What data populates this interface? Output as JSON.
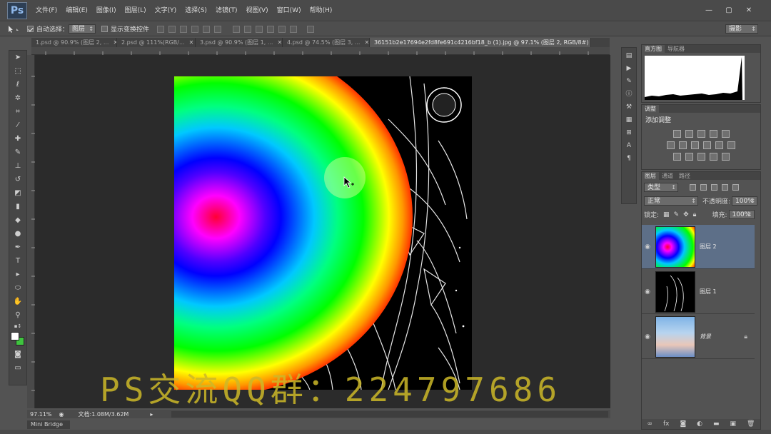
{
  "app": {
    "logo": "Ps"
  },
  "menu": [
    "文件(F)",
    "编辑(E)",
    "图像(I)",
    "图层(L)",
    "文字(Y)",
    "选择(S)",
    "滤镜(T)",
    "视图(V)",
    "窗口(W)",
    "帮助(H)"
  ],
  "window_controls": {
    "minimize": "—",
    "restore": "▢",
    "close": "✕"
  },
  "options": {
    "auto_select_label": "自动选择：",
    "auto_select_value": "图层",
    "show_transform_label": "显示变换控件",
    "workspace": "摄影"
  },
  "tabs": [
    {
      "label": "1.psd @ 90.9% (图层 2, ..."
    },
    {
      "label": "2.psd @ 111%(RGB/..."
    },
    {
      "label": "3.psd @ 90.9% (图层 1, ..."
    },
    {
      "label": "4.psd @ 74.5% (图层 3, ..."
    },
    {
      "label": "36151b2e17694e2fd8fe691c4216bf18_b (1).jpg @ 97.1% (图层 2, RGB/8#) *"
    }
  ],
  "status": {
    "zoom": "97.11%",
    "doc": "文档:1.08M/3.62M"
  },
  "mini_bridge": "Mini Bridge",
  "panels": {
    "hist_tabs": [
      "直方图",
      "导航器"
    ],
    "adj_tab": "调整",
    "adj_title": "添加调整",
    "layer_tabs": [
      "图层",
      "通道",
      "路径"
    ],
    "kind_filter": "类型",
    "blend_mode": "正常",
    "opacity_label": "不透明度:",
    "opacity_value": "100%",
    "lock_label": "锁定:",
    "fill_label": "填充:",
    "fill_value": "100%"
  },
  "layers": [
    {
      "name": "图层 2",
      "active": true
    },
    {
      "name": "图层 1",
      "active": false
    },
    {
      "name": "背景",
      "active": false
    }
  ],
  "watermark": "PS交流QQ群：224797686",
  "colors": {
    "menubar": "#4a4a4a",
    "panel": "#535353",
    "active_layer": "#5d6f88",
    "watermark": "#cdb928"
  }
}
